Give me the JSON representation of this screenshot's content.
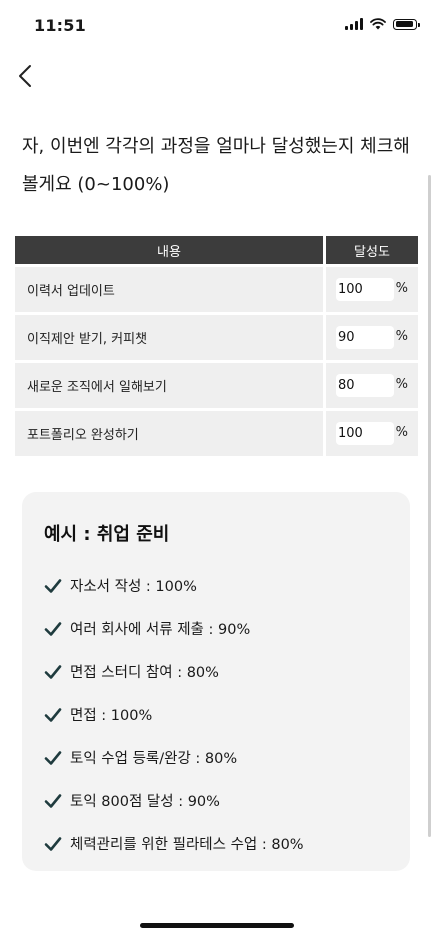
{
  "status_bar": {
    "time": "11:51"
  },
  "header": {
    "back_icon": "chevron-left-icon"
  },
  "question": "자, 이번엔 각각의 과정을 얼마나 달성했는지 체크해 볼게요 (0~100%)",
  "table": {
    "headers": {
      "content": "내용",
      "rate": "달성도"
    },
    "unit": "%",
    "rows": [
      {
        "label": "이력서 업데이트",
        "value": "100"
      },
      {
        "label": "이직제안 받기, 커피챗",
        "value": "90"
      },
      {
        "label": "새로운 조직에서 일해보기",
        "value": "80"
      },
      {
        "label": "포트폴리오 완성하기",
        "value": "100"
      }
    ]
  },
  "example": {
    "title": "예시 : 취업 준비",
    "items": [
      "자소서 작성 : 100%",
      "여러 회사에 서류 제출 : 90%",
      "면접 스터디 참여 : 80%",
      "면접 : 100%",
      "토익 수업 등록/완강 : 80%",
      "토익 800점 달성 : 90%",
      "체력관리를 위한 필라테스 수업 : 80%"
    ],
    "check_color": "#1f3b3e",
    "check_icon": "check-icon"
  }
}
